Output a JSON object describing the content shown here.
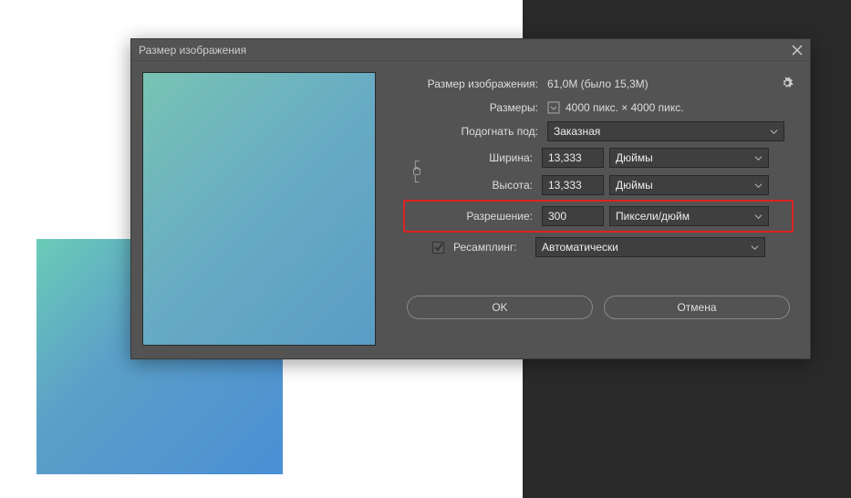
{
  "dialog": {
    "title": "Размер изображения",
    "sizeLabel": "Размер изображения:",
    "sizeValue": "61,0M (было 15,3M)",
    "dimensionsLabel": "Размеры:",
    "dimensionsValue": "4000 пикс. × 4000 пикс.",
    "fitLabel": "Подогнать под:",
    "fitValue": "Заказная",
    "widthLabel": "Ширина:",
    "widthValue": "13,333",
    "widthUnit": "Дюймы",
    "heightLabel": "Высота:",
    "heightValue": "13,333",
    "heightUnit": "Дюймы",
    "resolutionLabel": "Разрешение:",
    "resolutionValue": "300",
    "resolutionUnit": "Пиксели/дюйм",
    "resampleLabel": "Ресамплинг:",
    "resampleValue": "Автоматически",
    "okLabel": "OK",
    "cancelLabel": "Отмена"
  }
}
